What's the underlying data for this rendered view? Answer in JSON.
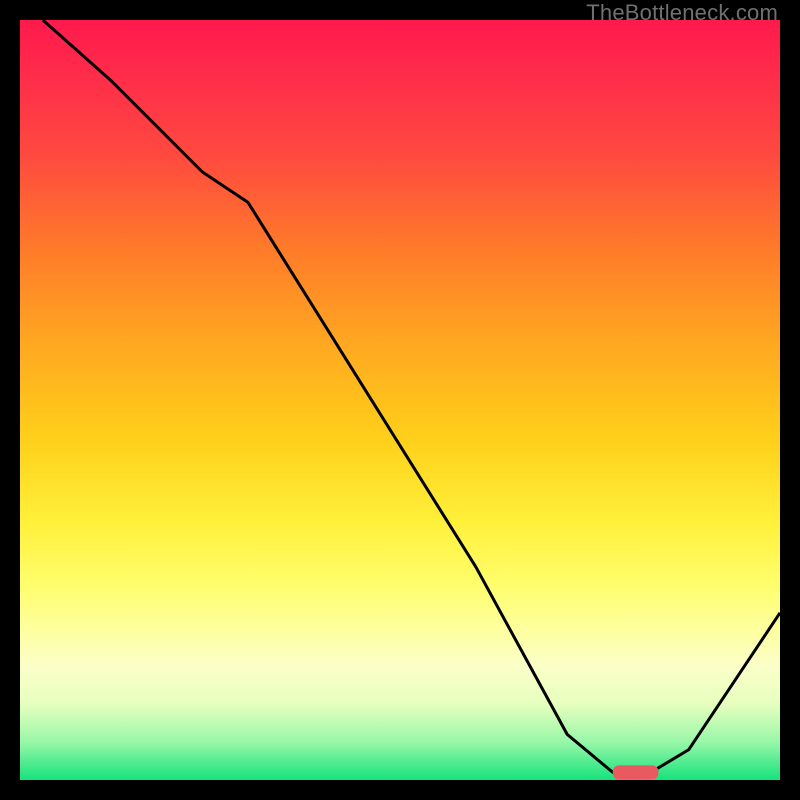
{
  "watermark": "TheBottleneck.com",
  "chart_data": {
    "type": "line",
    "title": "",
    "xlabel": "",
    "ylabel": "",
    "xlim": [
      0,
      100
    ],
    "ylim": [
      0,
      100
    ],
    "series": [
      {
        "name": "curve",
        "x": [
          3,
          12,
          24,
          30,
          45,
          60,
          72,
          78,
          83,
          88,
          100
        ],
        "y": [
          100,
          92,
          80,
          76,
          52,
          28,
          6,
          1,
          1,
          4,
          22
        ]
      }
    ],
    "marker": {
      "x_start": 78,
      "x_end": 84,
      "y": 1
    },
    "gradient_stops": [
      {
        "pos": 0,
        "color": "#ff1a4d"
      },
      {
        "pos": 18,
        "color": "#ff4a3f"
      },
      {
        "pos": 42,
        "color": "#ffa621"
      },
      {
        "pos": 66,
        "color": "#fff03a"
      },
      {
        "pos": 85,
        "color": "#fbffc8"
      },
      {
        "pos": 100,
        "color": "#16e27c"
      }
    ]
  }
}
